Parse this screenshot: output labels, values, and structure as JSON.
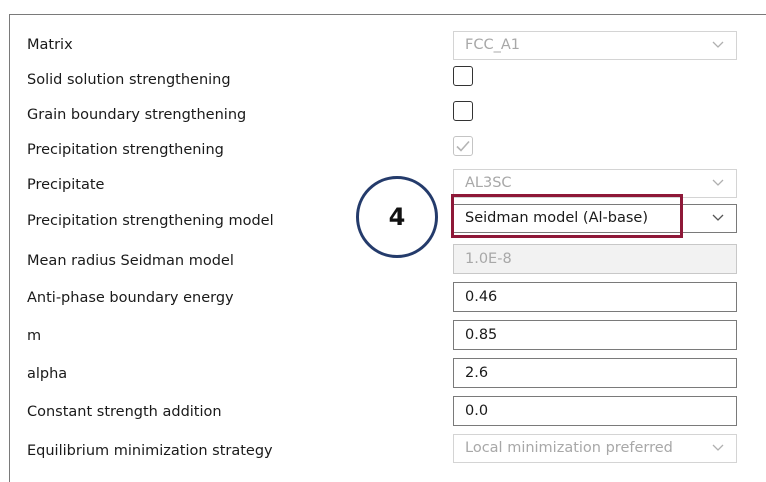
{
  "properties": [
    {
      "label": "Matrix",
      "type": "combo",
      "value": "FCC_A1",
      "disabled": true
    },
    {
      "label": "Solid solution strengthening",
      "type": "checkbox",
      "checked": false
    },
    {
      "label": "Grain boundary strengthening",
      "type": "checkbox",
      "checked": false
    },
    {
      "label": "Precipitation strengthening",
      "type": "checkbox",
      "checked": true,
      "disabled": true
    },
    {
      "label": "Precipitate",
      "type": "combo",
      "value": "AL3SC",
      "disabled": true
    },
    {
      "label": "Precipitation strengthening model",
      "type": "combo",
      "value": "Seidman model (Al-base)",
      "disabled": false
    },
    {
      "label": "Mean radius Seidman model",
      "type": "text",
      "value": "1.0E-8",
      "disabled": true
    },
    {
      "label": "Anti-phase boundary energy",
      "type": "text",
      "value": "0.46"
    },
    {
      "label": "m",
      "type": "text",
      "value": "0.85"
    },
    {
      "label": "alpha",
      "type": "text",
      "value": "2.6"
    },
    {
      "label": "Constant strength addition",
      "type": "text",
      "value": "0.0"
    },
    {
      "label": "Equilibrium minimization strategy",
      "type": "combo",
      "value": "Local minimization preferred",
      "disabled": true
    }
  ],
  "callout": {
    "number": "4"
  },
  "colors": {
    "highlight": "#8e1838",
    "callout_ring": "#243b6b"
  }
}
